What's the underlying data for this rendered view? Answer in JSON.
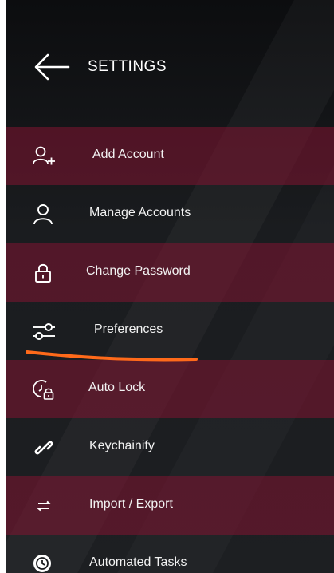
{
  "header": {
    "title": "SETTINGS",
    "back_icon": "arrow-left-icon"
  },
  "menu": {
    "items": [
      {
        "label": "Add Account",
        "icon": "add-user-icon",
        "style": "highlighted"
      },
      {
        "label": "Manage Accounts",
        "icon": "user-icon",
        "style": "plain"
      },
      {
        "label": "Change Password",
        "icon": "lock-icon",
        "style": "highlighted"
      },
      {
        "label": "Preferences",
        "icon": "sliders-icon",
        "style": "plain"
      },
      {
        "label": "Auto Lock",
        "icon": "clock-lock-icon",
        "style": "highlighted"
      },
      {
        "label": "Keychainify",
        "icon": "link-icon",
        "style": "plain"
      },
      {
        "label": "Import / Export",
        "icon": "swap-arrows-icon",
        "style": "highlighted"
      },
      {
        "label": "Automated Tasks",
        "icon": "timer-icon",
        "style": "plain"
      }
    ]
  },
  "colors": {
    "highlight_row": "#82143280",
    "annotation_stroke": "#ff6a1a",
    "background": "#1a1c1f"
  }
}
